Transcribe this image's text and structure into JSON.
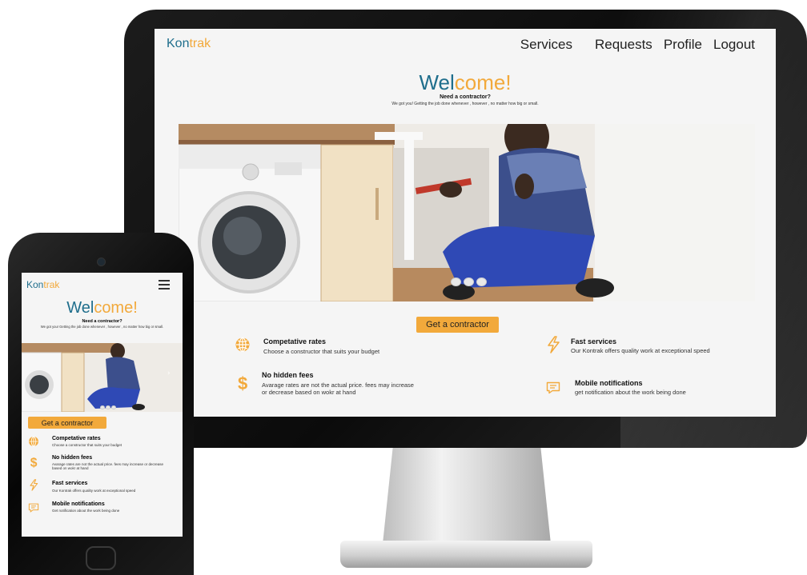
{
  "brand": {
    "part1": "Kon",
    "part2": "trak",
    "color_primary": "#1f6e8c",
    "color_accent": "#f2a93b"
  },
  "nav": {
    "services": "Services",
    "requests": "Requests",
    "profile": "Profile",
    "logout": "Logout"
  },
  "hero": {
    "welcome_part1": "Wel",
    "welcome_part2": "come!",
    "need": "Need a contractor?",
    "subtitle": "We got you! Getting the job done whenever , however , no matter how big or small."
  },
  "carousel": {
    "slides": 3,
    "image_icon": "plumber-photo"
  },
  "cta_label": "Get a contractor",
  "features": [
    {
      "icon": "globe-icon",
      "title": "Competative rates",
      "desc": "Choose a constructor that suits your budget"
    },
    {
      "icon": "dollar-icon",
      "title": "No hidden fees",
      "desc": "Avarage rates are not  the actual price. fees may increase or decrease based on wokr at hand"
    },
    {
      "icon": "lightning-icon",
      "title": "Fast services",
      "desc": "Our Kontrak offers quality work at exceptional speed"
    },
    {
      "icon": "message-icon",
      "title": "Mobile notifications",
      "desc": "get notification about the work being done"
    }
  ],
  "mobile": {
    "menu_icon": "hamburger-icon",
    "notif_desc": "Get notification about the work being done"
  }
}
